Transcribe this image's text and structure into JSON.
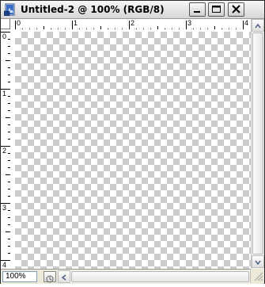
{
  "window": {
    "title": "Untitled-2 @ 100% (RGB/8)",
    "title_icon": "photoshop-document-icon",
    "controls": [
      "minimize-icon",
      "maximize-icon",
      "close-icon"
    ]
  },
  "ruler_top": {
    "labels": [
      "0",
      "1",
      "2",
      "3",
      "4"
    ]
  },
  "ruler_left": {
    "labels": [
      "0",
      "1",
      "2",
      "3",
      "4"
    ]
  },
  "canvas": {
    "background": "transparent-checkerboard",
    "checker_color": "#cccccc"
  },
  "status": {
    "zoom": "100%"
  },
  "colors": {
    "frame": "#ece9d8",
    "ruler": "#ffffff"
  }
}
